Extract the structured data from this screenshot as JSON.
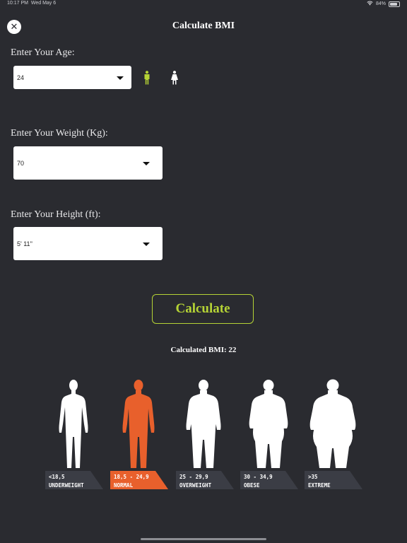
{
  "status_bar": {
    "time": "10:17 PM",
    "date": "Wed May 6",
    "battery": "84%",
    "battery_level": 0.84
  },
  "header": {
    "title": "Calculate BMI"
  },
  "age": {
    "label": "Enter Your Age:",
    "value": "24"
  },
  "weight": {
    "label": "Enter Your Weight (Kg):",
    "value": "70"
  },
  "height": {
    "label": "Enter Your Height (ft):",
    "value": "5' 11''"
  },
  "gender": {
    "selected": "male",
    "selected_color": "#b5d335"
  },
  "calculate_button": {
    "label": "Calculate"
  },
  "result": {
    "text": "Calculated BMI: 22"
  },
  "categories": [
    {
      "range": "<18,5",
      "name": "UNDERWEIGHT",
      "active": false
    },
    {
      "range": "18,5 - 24,9",
      "name": "NORMAL",
      "active": true
    },
    {
      "range": "25 - 29,9",
      "name": "OVERWEIGHT",
      "active": false
    },
    {
      "range": "30 - 34,9",
      "name": "OBESE",
      "active": false
    },
    {
      "range": ">35",
      "name": "EXTREME",
      "active": false
    }
  ],
  "colors": {
    "accent": "#b5d335",
    "active": "#e8602c",
    "background": "#2a2b30",
    "tag_bg": "#3b3d45"
  }
}
